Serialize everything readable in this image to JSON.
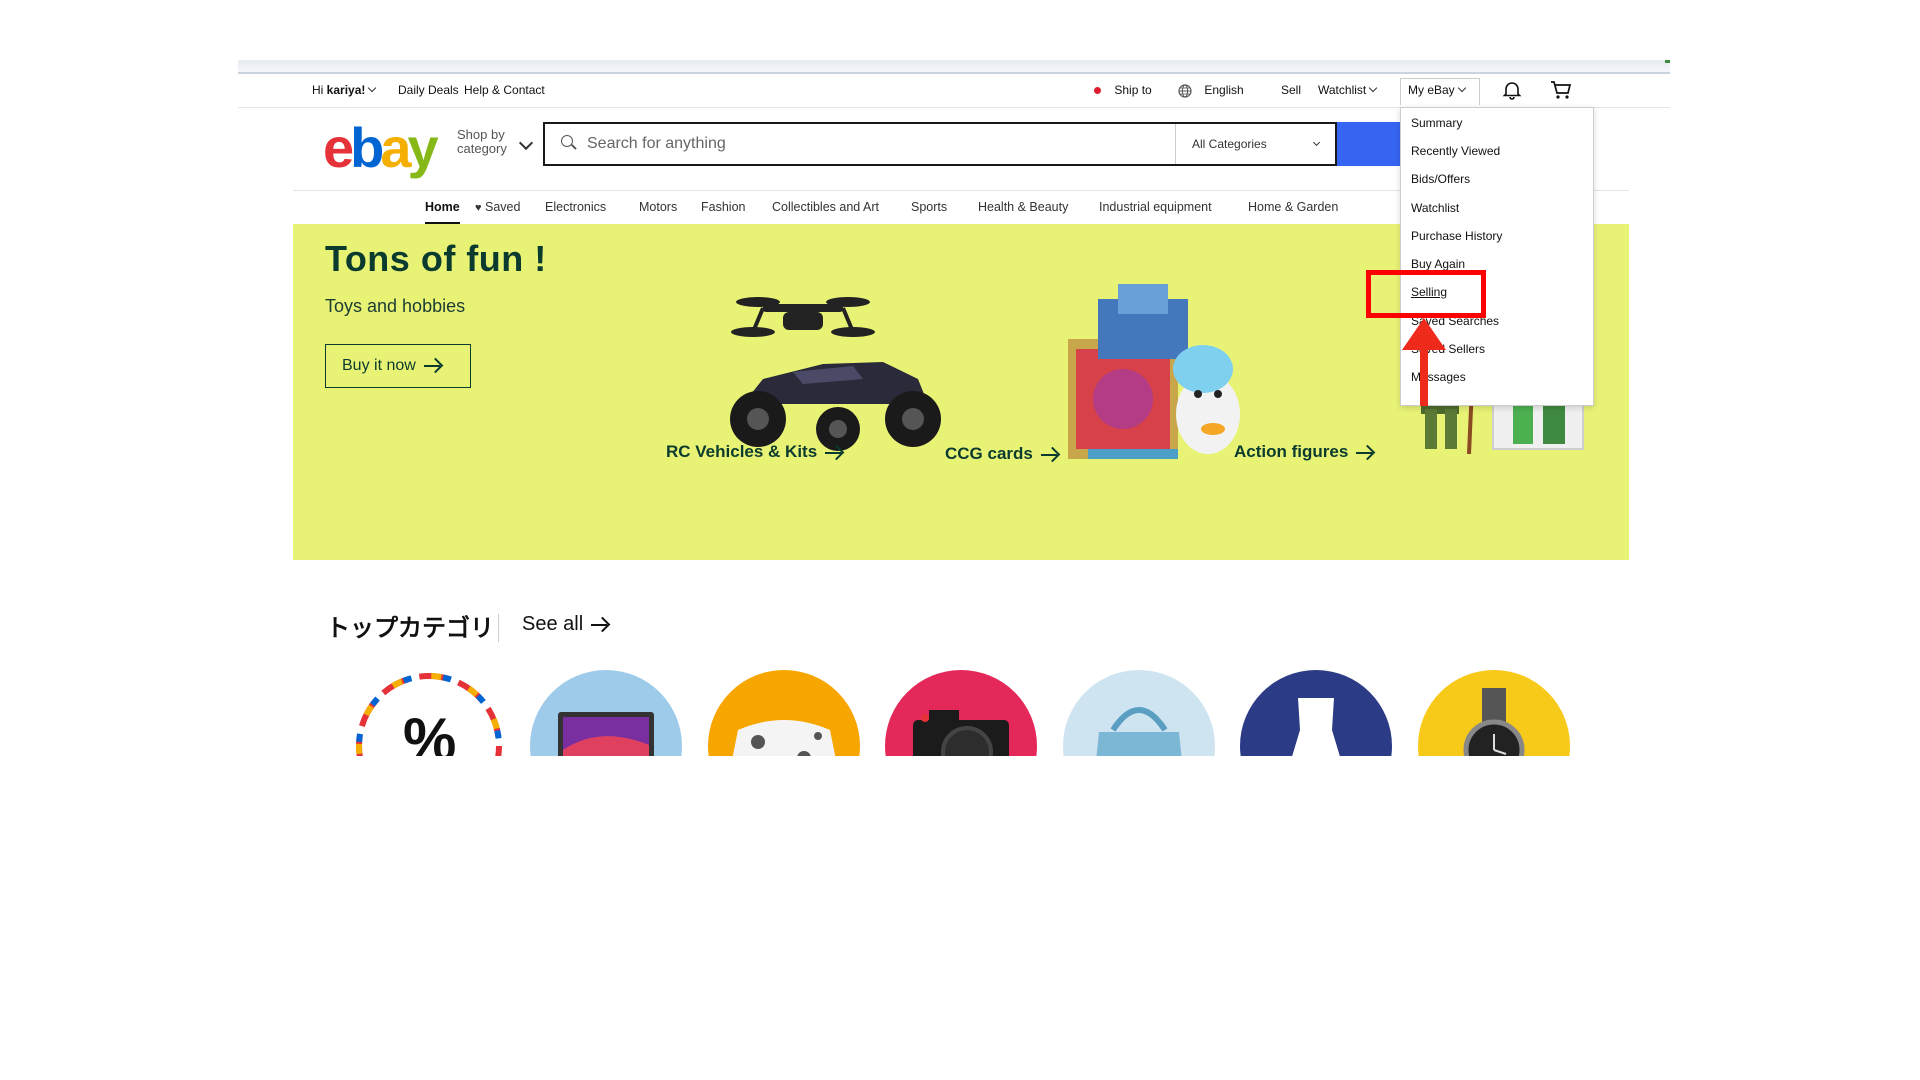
{
  "toolbar": {
    "greeting_prefix": "Hi ",
    "username": "kariya!",
    "daily_deals": "Daily Deals",
    "help_contact": "Help & Contact",
    "ship_to": "Ship to",
    "language": "English",
    "sell": "Sell",
    "watchlist": "Watchlist",
    "my_ebay": "My eBay"
  },
  "header": {
    "logo": {
      "e": "e",
      "b": "b",
      "a": "a",
      "y": "y"
    },
    "shop_by_line1": "Shop by",
    "shop_by_line2": "category",
    "search_placeholder": "Search for anything",
    "category_select": "All Categories"
  },
  "nav": {
    "items": [
      "Home",
      "Saved",
      "Electronics",
      "Motors",
      "Fashion",
      "Collectibles and Art",
      "Sports",
      "Health & Beauty",
      "Industrial equipment",
      "Home & Garden"
    ]
  },
  "hero": {
    "title": "Tons of fun !",
    "subtitle": "Toys and hobbies",
    "button": "Buy it now",
    "captions": [
      "RC Vehicles & Kits",
      "CCG cards",
      "Action figures"
    ]
  },
  "top_categories": {
    "title": "トップカテゴリ",
    "see_all": "See all"
  },
  "dropdown": {
    "items": [
      "Summary",
      "Recently Viewed",
      "Bids/Offers",
      "Watchlist",
      "Purchase History",
      "Buy Again",
      "Selling",
      "Saved Searches",
      "Saved Sellers",
      "Messages"
    ],
    "selected": "Selling"
  },
  "colors": {
    "hero_bg": "#e8f376",
    "accent_blue": "#3665f3",
    "annotation_red": "#ff0000"
  }
}
